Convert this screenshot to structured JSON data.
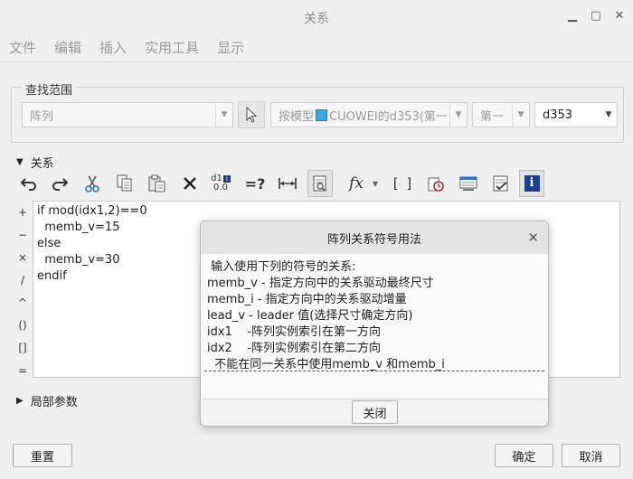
{
  "window": {
    "title": "关系"
  },
  "menu": [
    "文件",
    "编辑",
    "插入",
    "实用工具",
    "显示"
  ],
  "search_scope": {
    "label": "查找范围",
    "type_select": "阵列",
    "model_select_prefix": "按模型",
    "model_select_name": "CUOWEI的d353(第一",
    "direction_select": "第一",
    "dimension_select": "d353"
  },
  "relations": {
    "label": "关系",
    "operators": [
      "+",
      "−",
      "×",
      "/",
      "^",
      "()",
      "[]",
      "="
    ],
    "code": "if mod(idx1,2)==0\n  memb_v=15\nelse\n  memb_v=30\nendif",
    "toolbar": {
      "eval_label": "=?",
      "fx_label": "fx",
      "brackets_label": "[ ]",
      "d1_label": "d1",
      "d1_value": "0.0"
    }
  },
  "local_params": {
    "label": "局部参数"
  },
  "buttons": {
    "reset": "重置",
    "ok": "确定",
    "cancel": "取消"
  },
  "dialog": {
    "title": "阵列关系符号用法",
    "lines": [
      " 输入使用下列的符号的关系:",
      "memb_v - 指定方向中的关系驱动最终尺寸",
      "memb_i - 指定方向中的关系驱动增量",
      "lead_v - leader 值(选择尺寸确定方向)",
      "idx1    -阵列实例索引在第一方向",
      "idx2    -阵列实例索引在第二方向",
      "  不能在同一关系中使用memb_v 和memb_i"
    ],
    "close_label": "关闭"
  },
  "colors": {
    "cube": "#3aa8e0",
    "info": "#1b3f8a"
  }
}
